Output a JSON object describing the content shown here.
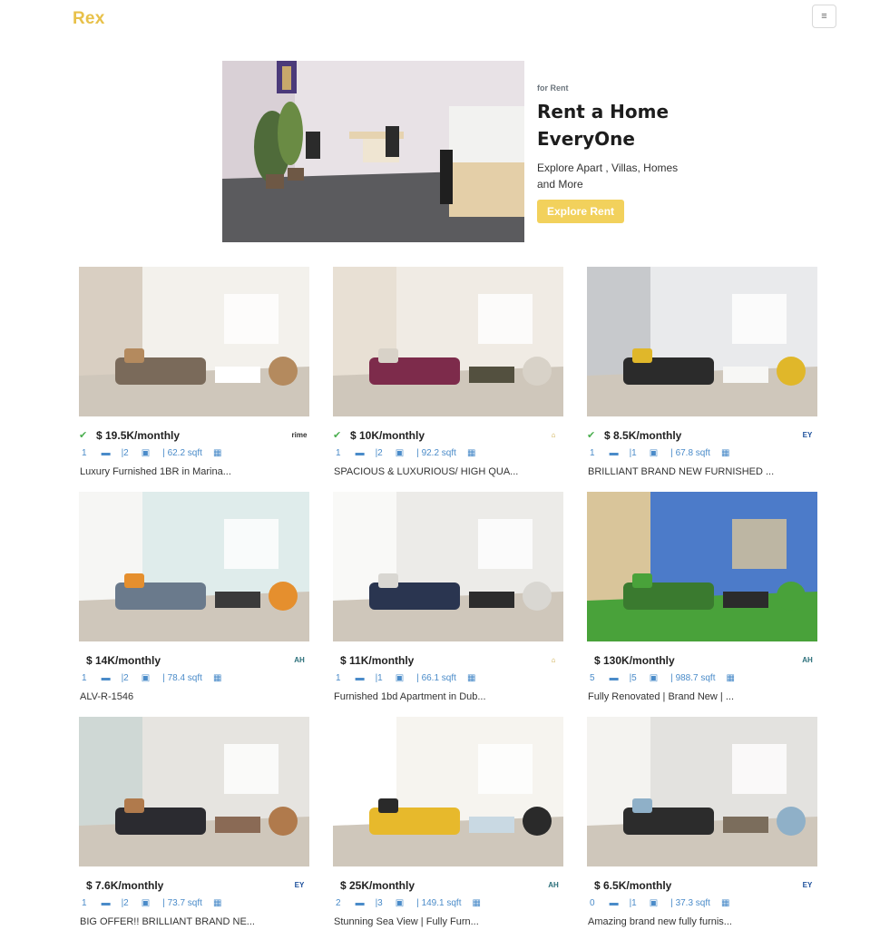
{
  "nav": {
    "brand": "Rex",
    "menu_icon": "hamburger-icon",
    "menu_glyph": "≡"
  },
  "hero": {
    "eyebrow": "for Rent",
    "title_line1": "Rent a Home",
    "title_line2": "EveryOne",
    "subtitle": "Explore Apart , Villas, Homes and More",
    "cta": "Explore Rent"
  },
  "icons": {
    "verified": "verified-check-icon",
    "bed": "bed-icon",
    "bath": "bath-icon",
    "area": "area-grid-icon"
  },
  "listings": [
    {
      "price": "$ 19.5K/monthly",
      "verified": true,
      "agency": "rime",
      "beds": "1",
      "baths": "2",
      "area": "62.2 sqft",
      "title": "Luxury Furnished 1BR in Marina..."
    },
    {
      "price": "$ 10K/monthly",
      "verified": true,
      "agency": "",
      "beds": "1",
      "baths": "2",
      "area": "92.2 sqft",
      "title": "SPACIOUS & LUXURIOUS/ HIGH QUA..."
    },
    {
      "price": "$ 8.5K/monthly",
      "verified": true,
      "agency": "EY",
      "beds": "1",
      "baths": "1",
      "area": "67.8 sqft",
      "title": "BRILLIANT BRAND NEW FURNISHED ..."
    },
    {
      "price": "$ 14K/monthly",
      "verified": false,
      "agency": "AH",
      "beds": "1",
      "baths": "2",
      "area": "78.4 sqft",
      "title": "ALV-R-1546"
    },
    {
      "price": "$ 11K/monthly",
      "verified": false,
      "agency": "",
      "beds": "1",
      "baths": "1",
      "area": "66.1 sqft",
      "title": "Furnished 1bd Apartment in Dub..."
    },
    {
      "price": "$ 130K/monthly",
      "verified": false,
      "agency": "AH",
      "beds": "5",
      "baths": "5",
      "area": "988.7 sqft",
      "title": "Fully Renovated | Brand New | ..."
    },
    {
      "price": "$ 7.6K/monthly",
      "verified": false,
      "agency": "EY",
      "beds": "1",
      "baths": "2",
      "area": "73.7 sqft",
      "title": "BIG OFFER!! BRILLIANT BRAND NE..."
    },
    {
      "price": "$ 25K/monthly",
      "verified": false,
      "agency": "AH",
      "beds": "2",
      "baths": "3",
      "area": "149.1 sqft",
      "title": "Stunning Sea View | Fully Furn..."
    },
    {
      "price": "$ 6.5K/monthly",
      "verified": false,
      "agency": "EY",
      "beds": "0",
      "baths": "1",
      "area": "37.3 sqft",
      "title": "Amazing brand new fully furnis..."
    }
  ]
}
